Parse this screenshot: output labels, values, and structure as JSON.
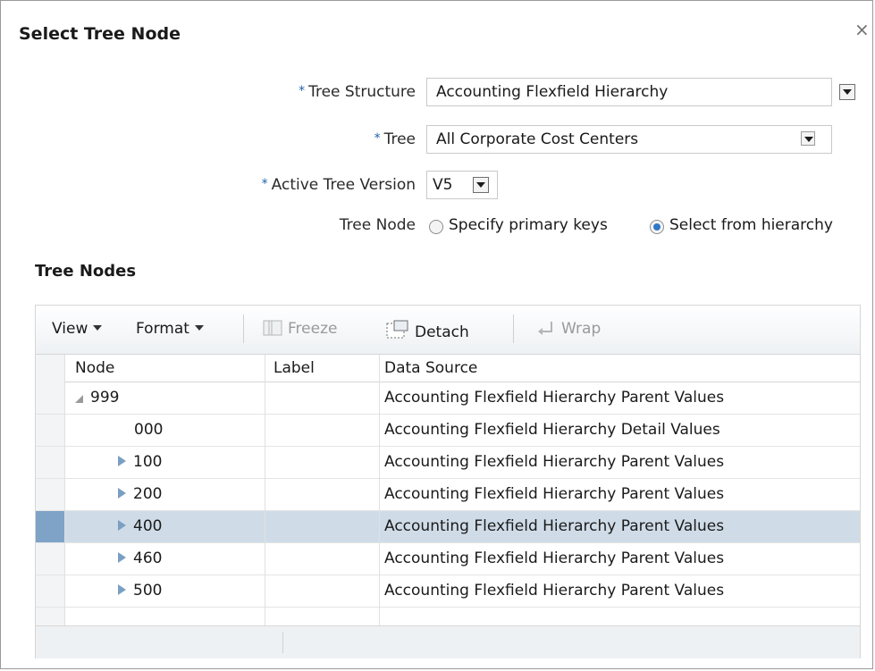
{
  "dialog": {
    "title": "Select Tree Node",
    "close_glyph": "×"
  },
  "form": {
    "required_mark": "*",
    "tree_structure": {
      "label": "Tree Structure",
      "value": "Accounting Flexfield Hierarchy"
    },
    "tree": {
      "label": "Tree",
      "value": "All Corporate Cost Centers"
    },
    "active_tree_version": {
      "label": "Active Tree Version",
      "value": "V5"
    },
    "tree_node": {
      "label": "Tree Node",
      "options": [
        {
          "label": "Specify primary keys",
          "selected": false
        },
        {
          "label": "Select from hierarchy",
          "selected": true
        }
      ]
    }
  },
  "tree_nodes": {
    "section_title": "Tree Nodes",
    "toolbar": {
      "view_label": "View",
      "format_label": "Format",
      "freeze_label": "Freeze",
      "detach_label": "Detach",
      "wrap_label": "Wrap"
    },
    "columns": [
      "Node",
      "Label",
      "Data Source"
    ],
    "rows": [
      {
        "node": "999",
        "label": "",
        "data_source": "Accounting Flexfield Hierarchy Parent Values",
        "expander": "expanded",
        "selected": false
      },
      {
        "node": "000",
        "label": "",
        "data_source": "Accounting Flexfield Hierarchy Detail Values",
        "expander": "none",
        "selected": false
      },
      {
        "node": "100",
        "label": "",
        "data_source": "Accounting Flexfield Hierarchy Parent Values",
        "expander": "collapsed",
        "selected": false
      },
      {
        "node": "200",
        "label": "",
        "data_source": "Accounting Flexfield Hierarchy Parent Values",
        "expander": "collapsed",
        "selected": false
      },
      {
        "node": "400",
        "label": "",
        "data_source": "Accounting Flexfield Hierarchy Parent Values",
        "expander": "collapsed",
        "selected": true
      },
      {
        "node": "460",
        "label": "",
        "data_source": "Accounting Flexfield Hierarchy Parent Values",
        "expander": "collapsed",
        "selected": false
      },
      {
        "node": "500",
        "label": "",
        "data_source": "Accounting Flexfield Hierarchy Parent Values",
        "expander": "collapsed",
        "selected": false
      }
    ]
  },
  "colors": {
    "selected_row": "#cfdce8",
    "selected_row_header": "#7ea3c7",
    "required_mark": "#1f5fa8",
    "radio_selected": "#2f78c8"
  },
  "icons": {
    "close": "close-icon",
    "dropdown": "chevron-down-icon",
    "freeze": "freeze-icon",
    "detach": "detach-icon",
    "wrap": "wrap-icon",
    "expanded": "tree-expanded-icon",
    "collapsed": "tree-collapsed-icon"
  }
}
